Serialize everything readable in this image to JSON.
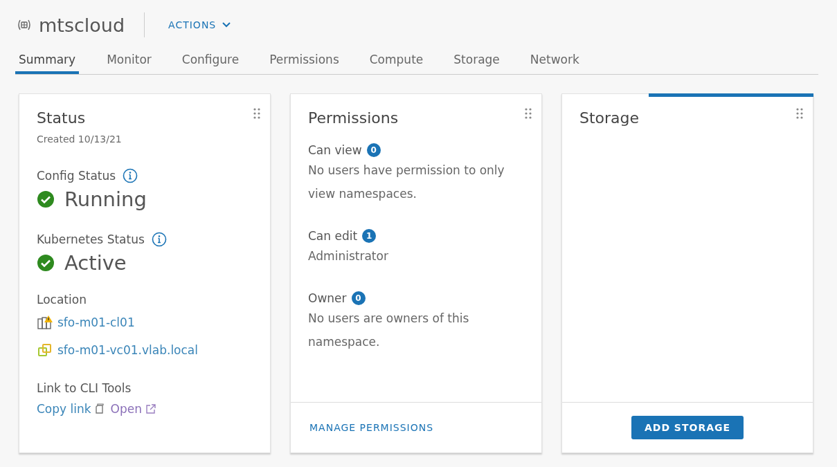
{
  "header": {
    "title": "mtscloud",
    "actions_label": "ACTIONS"
  },
  "tabs": [
    {
      "label": "Summary",
      "selected": true
    },
    {
      "label": "Monitor",
      "selected": false
    },
    {
      "label": "Configure",
      "selected": false
    },
    {
      "label": "Permissions",
      "selected": false
    },
    {
      "label": "Compute",
      "selected": false
    },
    {
      "label": "Storage",
      "selected": false
    },
    {
      "label": "Network",
      "selected": false
    }
  ],
  "status_card": {
    "title": "Status",
    "created": "Created 10/13/21",
    "statuses": [
      {
        "label": "Config Status",
        "value": "Running",
        "ok": true
      },
      {
        "label": "Kubernetes Status",
        "value": "Active",
        "ok": true
      }
    ],
    "location_label": "Location",
    "locations": [
      {
        "kind": "cluster",
        "name": "sfo-m01-cl01"
      },
      {
        "kind": "vcenter",
        "name": "sfo-m01-vc01.vlab.local"
      }
    ],
    "cli_label": "Link to CLI Tools",
    "copy_link": "Copy link",
    "open_link": "Open"
  },
  "permissions_card": {
    "title": "Permissions",
    "groups": [
      {
        "label": "Can view",
        "count": "0",
        "text": "No users have permission to only view namespaces."
      },
      {
        "label": "Can edit",
        "count": "1",
        "text": "Administrator"
      },
      {
        "label": "Owner",
        "count": "0",
        "text": "No users are owners of this namespace."
      }
    ],
    "footer_link": "MANAGE PERMISSIONS"
  },
  "storage_card": {
    "title": "Storage",
    "loading": true,
    "button": "ADD STORAGE"
  }
}
